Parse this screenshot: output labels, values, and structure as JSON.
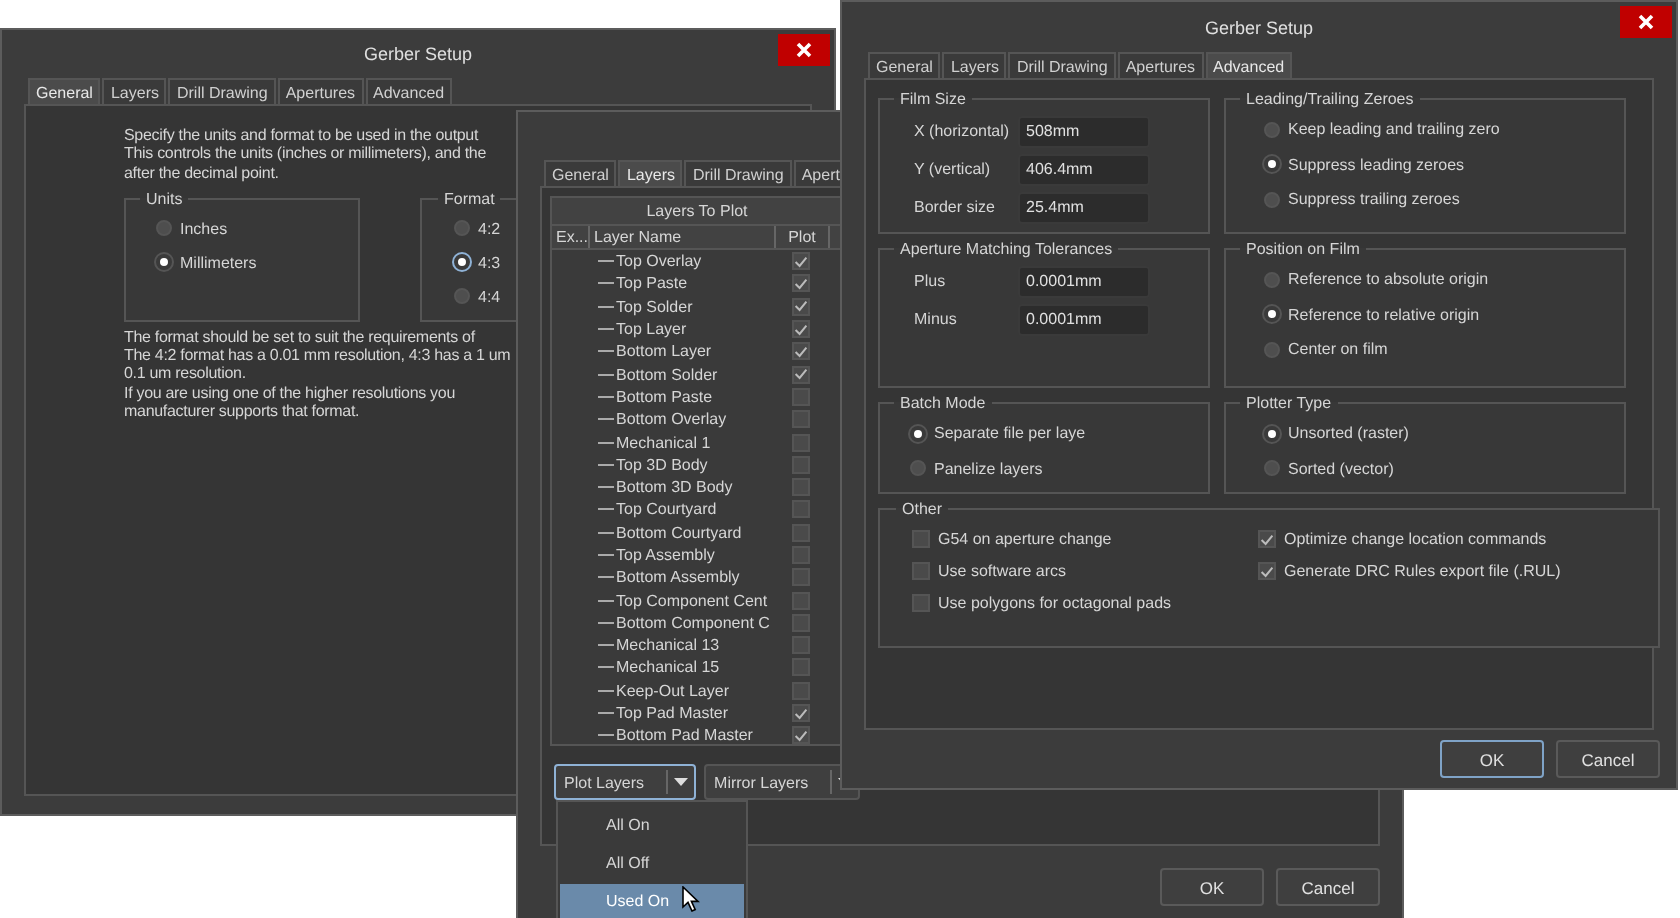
{
  "general_window": {
    "title": "Gerber Setup",
    "tabs": [
      {
        "label": "General",
        "selected": true
      },
      {
        "label": "Layers",
        "selected": false
      },
      {
        "label": "Drill Drawing",
        "selected": false
      },
      {
        "label": "Apertures",
        "selected": false
      },
      {
        "label": "Advanced",
        "selected": false
      }
    ],
    "intro": [
      "Specify the units and format to be used in the output",
      "This controls the units (inches or millimeters), and the",
      "after the decimal point."
    ],
    "units": {
      "title": "Units",
      "options": [
        {
          "label": "Inches",
          "selected": false
        },
        {
          "label": "Millimeters",
          "selected": true
        }
      ]
    },
    "format": {
      "title": "Format",
      "options": [
        {
          "label": "4:2",
          "selected": false
        },
        {
          "label": "4:3",
          "selected": true
        },
        {
          "label": "4:4",
          "selected": false
        }
      ]
    },
    "notes": [
      "The format should be set to suit the requirements of",
      "The 4:2 format has a 0.01 mm resolution, 4:3 has a 1 um",
      "0.1 um resolution.",
      "If you are using one of the higher resolutions you",
      "manufacturer supports that format."
    ]
  },
  "layers_window": {
    "tabs": [
      {
        "label": "General",
        "selected": false
      },
      {
        "label": "Layers",
        "selected": true
      },
      {
        "label": "Drill Drawing",
        "selected": false
      },
      {
        "label": "Apert",
        "selected": false
      }
    ],
    "table": {
      "title": "Layers To Plot",
      "columns": [
        "Ex...",
        "Layer Name",
        "Plot"
      ],
      "rows": [
        {
          "name": "Top Overlay",
          "plot": true
        },
        {
          "name": "Top Paste",
          "plot": true
        },
        {
          "name": "Top Solder",
          "plot": true
        },
        {
          "name": "Top Layer",
          "plot": true
        },
        {
          "name": "Bottom Layer",
          "plot": true
        },
        {
          "name": "Bottom Solder",
          "plot": true
        },
        {
          "name": "Bottom Paste",
          "plot": false
        },
        {
          "name": "Bottom Overlay",
          "plot": false
        },
        {
          "name": "Mechanical 1",
          "plot": false
        },
        {
          "name": "Top 3D Body",
          "plot": false
        },
        {
          "name": "Bottom 3D Body",
          "plot": false
        },
        {
          "name": "Top Courtyard",
          "plot": false
        },
        {
          "name": "Bottom Courtyard",
          "plot": false
        },
        {
          "name": "Top Assembly",
          "plot": false
        },
        {
          "name": "Bottom Assembly",
          "plot": false
        },
        {
          "name": "Top Component Cent",
          "plot": false
        },
        {
          "name": "Bottom Component C",
          "plot": false
        },
        {
          "name": "Mechanical 13",
          "plot": false
        },
        {
          "name": "Mechanical 15",
          "plot": false
        },
        {
          "name": "Keep-Out Layer",
          "plot": false
        },
        {
          "name": "Top Pad Master",
          "plot": true
        },
        {
          "name": "Bottom Pad Master",
          "plot": true
        }
      ]
    },
    "dropdown_buttons": [
      {
        "label": "Plot Layers",
        "focused": true
      },
      {
        "label": "Mirror Layers",
        "focused": false
      }
    ],
    "menu": [
      {
        "label": "All On",
        "selected": false
      },
      {
        "label": "All Off",
        "selected": false
      },
      {
        "label": "Used On",
        "selected": true
      }
    ],
    "buttons": [
      {
        "label": "OK",
        "default": false
      },
      {
        "label": "Cancel",
        "default": false
      }
    ]
  },
  "advanced_window": {
    "title": "Gerber Setup",
    "tabs": [
      {
        "label": "General",
        "selected": false
      },
      {
        "label": "Layers",
        "selected": false
      },
      {
        "label": "Drill Drawing",
        "selected": false
      },
      {
        "label": "Apertures",
        "selected": false
      },
      {
        "label": "Advanced",
        "selected": true
      }
    ],
    "film_size": {
      "title": "Film Size",
      "fields": [
        {
          "label": "X (horizontal)",
          "value": "508mm"
        },
        {
          "label": "Y (vertical)",
          "value": "406.4mm"
        },
        {
          "label": "Border size",
          "value": "25.4mm"
        }
      ]
    },
    "zeroes": {
      "title": "Leading/Trailing Zeroes",
      "options": [
        {
          "label": "Keep leading and trailing zero",
          "selected": false
        },
        {
          "label": "Suppress leading zeroes",
          "selected": true
        },
        {
          "label": "Suppress trailing zeroes",
          "selected": false
        }
      ]
    },
    "tolerances": {
      "title": "Aperture Matching Tolerances",
      "fields": [
        {
          "label": "Plus",
          "value": "0.0001mm"
        },
        {
          "label": "Minus",
          "value": "0.0001mm"
        }
      ]
    },
    "position": {
      "title": "Position on Film",
      "options": [
        {
          "label": "Reference to absolute origin",
          "selected": false
        },
        {
          "label": "Reference to relative origin",
          "selected": true
        },
        {
          "label": "Center on film",
          "selected": false
        }
      ]
    },
    "batch_mode": {
      "title": "Batch Mode",
      "options": [
        {
          "label": "Separate file per laye",
          "selected": true
        },
        {
          "label": "Panelize layers",
          "selected": false
        }
      ]
    },
    "plotter_type": {
      "title": "Plotter Type",
      "options": [
        {
          "label": "Unsorted (raster)",
          "selected": true
        },
        {
          "label": "Sorted (vector)",
          "selected": false
        }
      ]
    },
    "other": {
      "title": "Other",
      "options": [
        {
          "label": "G54 on aperture change",
          "checked": false
        },
        {
          "label": "Use software arcs",
          "checked": false
        },
        {
          "label": "Use polygons for octagonal pads",
          "checked": false
        },
        {
          "label": "Optimize change location commands",
          "checked": true
        },
        {
          "label": "Generate DRC Rules export file (.RUL)",
          "checked": true
        }
      ]
    },
    "buttons": [
      {
        "label": "OK",
        "default": true
      },
      {
        "label": "Cancel",
        "default": false
      }
    ]
  }
}
